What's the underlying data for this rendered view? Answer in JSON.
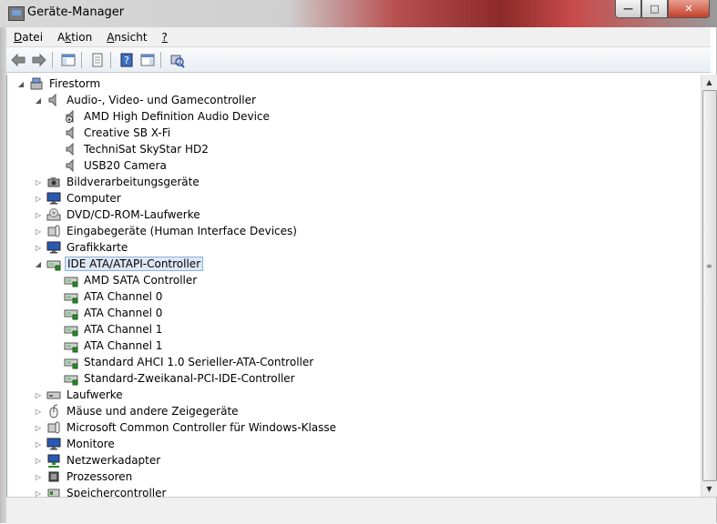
{
  "window": {
    "title": "Geräte-Manager",
    "minimize_label": "—",
    "maximize_label": "□",
    "close_label": "✕"
  },
  "menu": [
    {
      "label": "Datei",
      "accel": "D",
      "rest": "atei"
    },
    {
      "label": "Aktion",
      "pre": "A",
      "accel": "k",
      "rest": "tion"
    },
    {
      "label": "Ansicht",
      "accel": "A",
      "rest": "nsicht"
    },
    {
      "label": "?",
      "accel": "?",
      "rest": ""
    }
  ],
  "toolbar": [
    {
      "name": "back-icon"
    },
    {
      "name": "forward-icon"
    },
    {
      "sep": true
    },
    {
      "name": "show-hide-console-tree-icon"
    },
    {
      "sep": true
    },
    {
      "name": "properties-icon"
    },
    {
      "sep": true
    },
    {
      "name": "help-icon"
    },
    {
      "name": "show-action-pane-icon"
    },
    {
      "sep": true
    },
    {
      "name": "scan-hardware-icon"
    }
  ],
  "tree": [
    {
      "label": "Firestorm",
      "level": 0,
      "expander": "expanded",
      "icon": "computer-root"
    },
    {
      "label": "Audio-, Video- und Gamecontroller",
      "level": 1,
      "expander": "expanded",
      "icon": "speaker"
    },
    {
      "label": "AMD High Definition Audio Device",
      "level": 2,
      "expander": "none",
      "icon": "speaker-warning"
    },
    {
      "label": "Creative SB X-Fi",
      "level": 2,
      "expander": "none",
      "icon": "speaker"
    },
    {
      "label": "TechniSat SkyStar HD2",
      "level": 2,
      "expander": "none",
      "icon": "speaker"
    },
    {
      "label": "USB20 Camera",
      "level": 2,
      "expander": "none",
      "icon": "speaker"
    },
    {
      "label": "Bildverarbeitungsgeräte",
      "level": 1,
      "expander": "collapsed",
      "icon": "camera"
    },
    {
      "label": "Computer",
      "level": 1,
      "expander": "collapsed",
      "icon": "monitor"
    },
    {
      "label": "DVD/CD-ROM-Laufwerke",
      "level": 1,
      "expander": "collapsed",
      "icon": "dvd"
    },
    {
      "label": "Eingabegeräte (Human Interface Devices)",
      "level": 1,
      "expander": "collapsed",
      "icon": "hid"
    },
    {
      "label": "Grafikkarte",
      "level": 1,
      "expander": "collapsed",
      "icon": "monitor"
    },
    {
      "label": "IDE ATA/ATAPI-Controller",
      "level": 1,
      "expander": "expanded",
      "icon": "ide",
      "selected": true
    },
    {
      "label": "AMD SATA Controller",
      "level": 2,
      "expander": "none",
      "icon": "ide"
    },
    {
      "label": "ATA Channel 0",
      "level": 2,
      "expander": "none",
      "icon": "ide"
    },
    {
      "label": "ATA Channel 0",
      "level": 2,
      "expander": "none",
      "icon": "ide"
    },
    {
      "label": "ATA Channel 1",
      "level": 2,
      "expander": "none",
      "icon": "ide"
    },
    {
      "label": "ATA Channel 1",
      "level": 2,
      "expander": "none",
      "icon": "ide"
    },
    {
      "label": "Standard AHCI 1.0 Serieller-ATA-Controller",
      "level": 2,
      "expander": "none",
      "icon": "ide"
    },
    {
      "label": "Standard-Zweikanal-PCI-IDE-Controller",
      "level": 2,
      "expander": "none",
      "icon": "ide"
    },
    {
      "label": "Laufwerke",
      "level": 1,
      "expander": "collapsed",
      "icon": "disk"
    },
    {
      "label": "Mäuse und andere Zeigegeräte",
      "level": 1,
      "expander": "collapsed",
      "icon": "mouse"
    },
    {
      "label": "Microsoft Common Controller für Windows-Klasse",
      "level": 1,
      "expander": "collapsed",
      "icon": "hid"
    },
    {
      "label": "Monitore",
      "level": 1,
      "expander": "collapsed",
      "icon": "monitor"
    },
    {
      "label": "Netzwerkadapter",
      "level": 1,
      "expander": "collapsed",
      "icon": "network"
    },
    {
      "label": "Prozessoren",
      "level": 1,
      "expander": "collapsed",
      "icon": "cpu"
    },
    {
      "label": "Speichercontroller",
      "level": 1,
      "expander": "collapsed",
      "icon": "storage"
    }
  ],
  "scrollbar": {
    "up": "▲",
    "down": "▼",
    "grip": "≡"
  }
}
